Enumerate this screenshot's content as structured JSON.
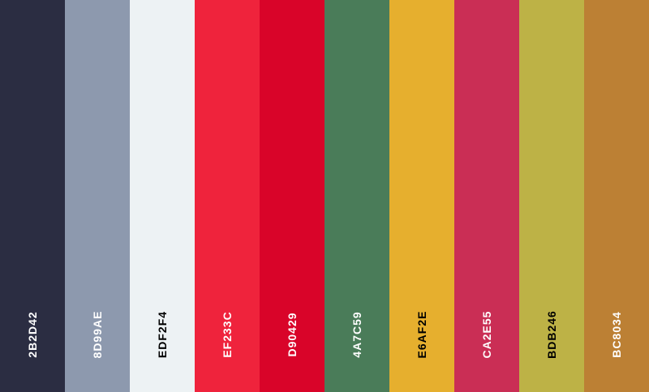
{
  "swatches": [
    {
      "hex": "2B2D42",
      "color": "#2b2d42",
      "text_color": "#ffffff"
    },
    {
      "hex": "8D99AE",
      "color": "#8d99ae",
      "text_color": "#ffffff"
    },
    {
      "hex": "EDF2F4",
      "color": "#edf2f4",
      "text_color": "#000000"
    },
    {
      "hex": "EF233C",
      "color": "#ef233c",
      "text_color": "#ffffff"
    },
    {
      "hex": "D90429",
      "color": "#d90429",
      "text_color": "#ffffff"
    },
    {
      "hex": "4A7C59",
      "color": "#4a7c59",
      "text_color": "#ffffff"
    },
    {
      "hex": "E6AF2E",
      "color": "#e6af2e",
      "text_color": "#000000"
    },
    {
      "hex": "CA2E55",
      "color": "#ca2e55",
      "text_color": "#ffffff"
    },
    {
      "hex": "BDB246",
      "color": "#bdb246",
      "text_color": "#000000"
    },
    {
      "hex": "BC8034",
      "color": "#bc8034",
      "text_color": "#ffffff"
    }
  ]
}
